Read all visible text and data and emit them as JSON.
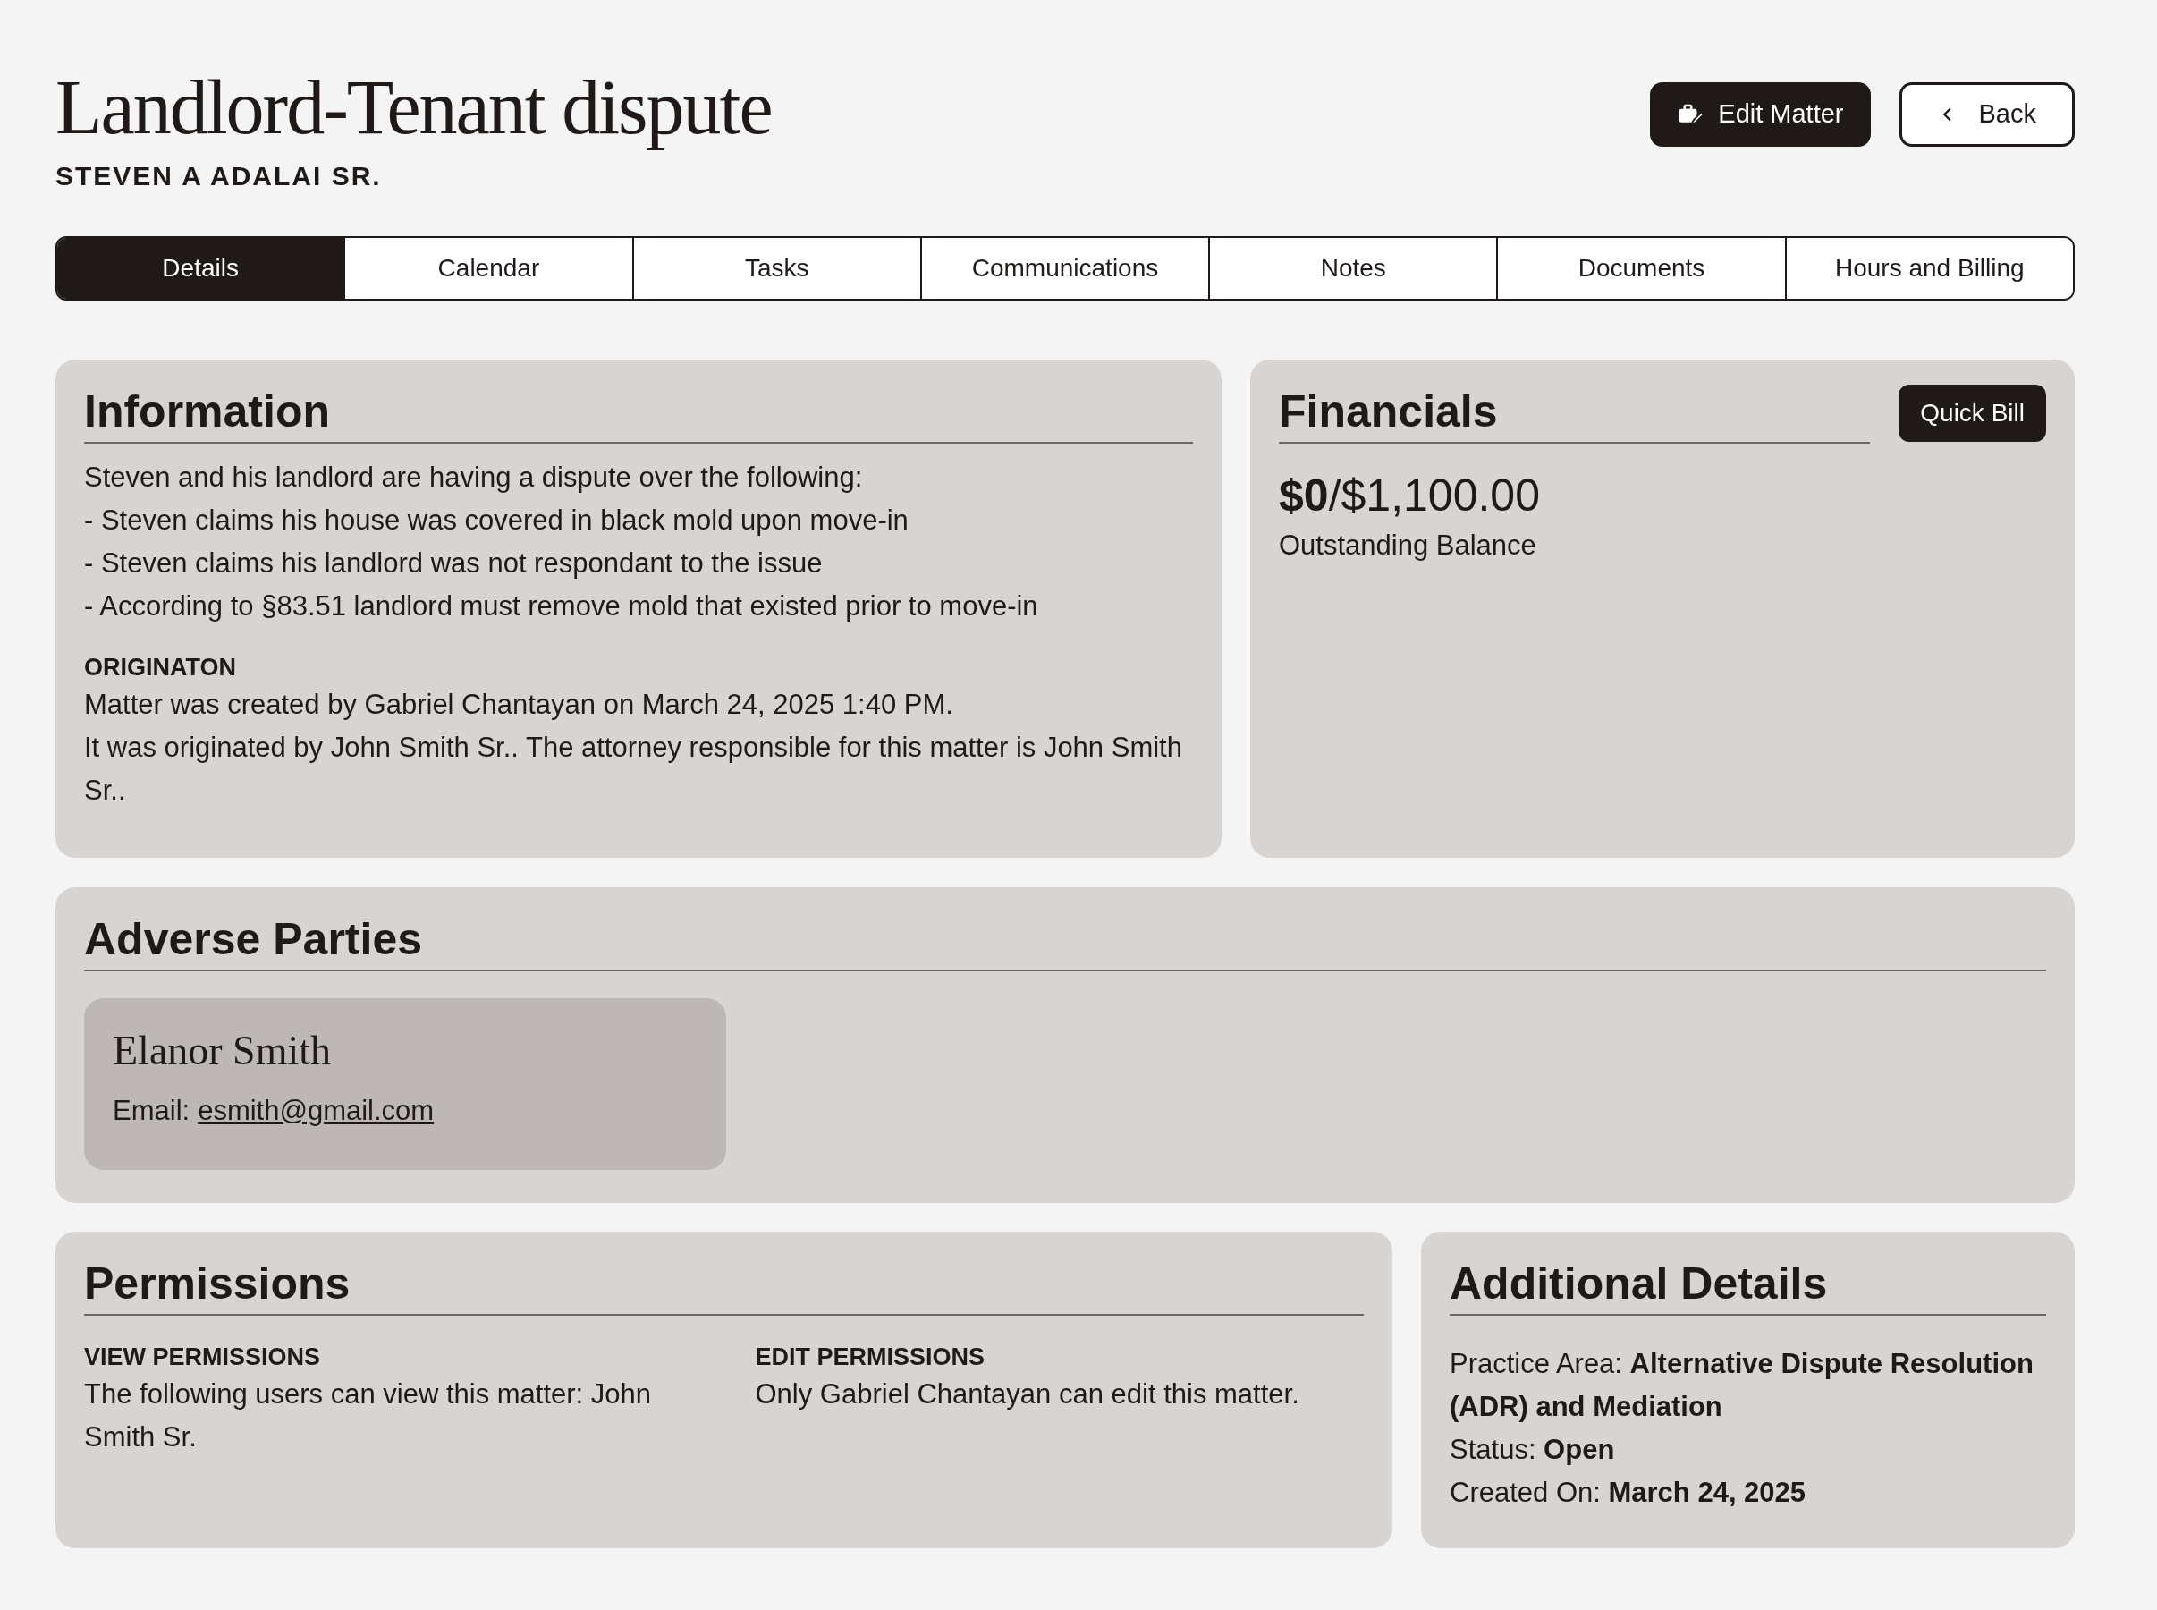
{
  "header": {
    "title": "Landlord-Tenant dispute",
    "client": "STEVEN A ADALAI SR.",
    "buttons": [
      {
        "kind": "edit",
        "label": "Edit Matter"
      },
      {
        "kind": "back",
        "label": "Back"
      }
    ]
  },
  "tabs": [
    {
      "label": "Details",
      "selected": true
    },
    {
      "label": "Calendar",
      "selected": false
    },
    {
      "label": "Tasks",
      "selected": false
    },
    {
      "label": "Communications",
      "selected": false
    },
    {
      "label": "Notes",
      "selected": false
    },
    {
      "label": "Documents",
      "selected": false
    },
    {
      "label": "Hours and Billing",
      "selected": false
    }
  ],
  "information": {
    "heading": "Information",
    "lines": [
      "Steven and his landlord are having a dispute over the following:",
      "- Steven claims his house was covered in black mold upon move-in",
      "- Steven claims his landlord was not respondant to the issue",
      "- According to §83.51 landlord must remove mold that existed prior to move-in"
    ],
    "origination_label": "ORIGINATON",
    "origination_lines": [
      "Matter was created by Gabriel Chantayan on March 24, 2025 1:40 PM.",
      "It was originated by John Smith Sr.. The attorney responsible for this matter is John Smith Sr.."
    ]
  },
  "financials": {
    "heading": "Financials",
    "button": "Quick Bill",
    "amount": "**$0**/$1,100.00",
    "caption": "Outstanding Balance"
  },
  "adverse_parties": {
    "heading": "Adverse Parties",
    "parties": [
      {
        "name": "Elanor Smith",
        "email_label": "Email:",
        "email": "esmith@gmail.com"
      }
    ]
  },
  "permissions": {
    "heading": "Permissions",
    "columns": [
      {
        "label": "VIEW PERMISSIONS",
        "text": "The following users can view this matter: John Smith Sr."
      },
      {
        "label": "EDIT PERMISSIONS",
        "text": "Only Gabriel Chantayan can edit this matter."
      }
    ]
  },
  "additional_details": {
    "heading": "Additional Details",
    "fields": [
      {
        "label": "Practice Area:",
        "value": "Alternative Dispute Resolution (ADR) and Mediation"
      },
      {
        "label": "Status:",
        "value": "Open"
      },
      {
        "label": "Created On:",
        "value": "March 24, 2025"
      }
    ]
  }
}
